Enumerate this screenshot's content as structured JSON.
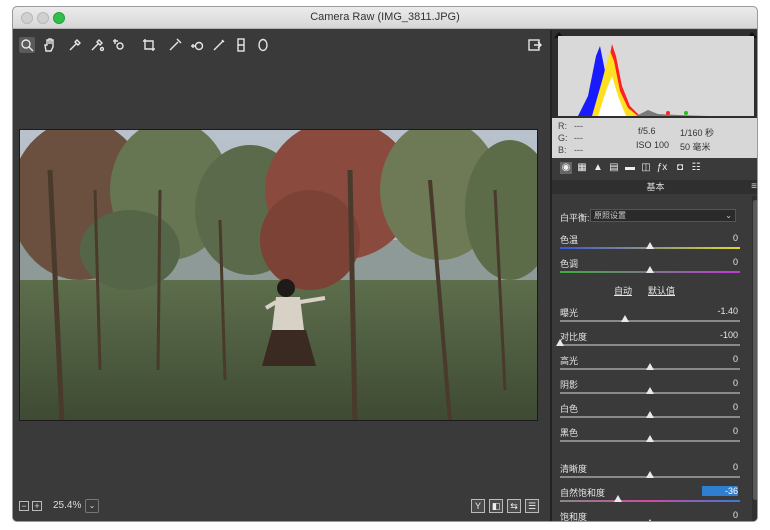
{
  "window": {
    "title": "Camera Raw (IMG_3811.JPG)"
  },
  "toolbar": {
    "tools": [
      {
        "name": "zoom-tool",
        "glyph": "⌕"
      },
      {
        "name": "hand-tool",
        "glyph": "✋"
      },
      {
        "name": "white-balance-tool",
        "glyph": "✎"
      },
      {
        "name": "color-sampler-tool",
        "glyph": "✎"
      },
      {
        "name": "targeted-adjustment-tool",
        "glyph": "◎"
      },
      {
        "name": "crop-tool",
        "glyph": "⌗"
      },
      {
        "name": "straighten-tool",
        "glyph": "⟋"
      },
      {
        "name": "spot-removal-tool",
        "glyph": "⊙"
      },
      {
        "name": "adjustment-brush-tool",
        "glyph": "✐"
      },
      {
        "name": "graduated-filter-tool",
        "glyph": "▮"
      },
      {
        "name": "radial-filter-tool",
        "glyph": "◯"
      }
    ]
  },
  "bottom": {
    "zoom": "25.4%",
    "zoom_out": "−",
    "zoom_in": "+",
    "zoom_dropdown": "⌄",
    "view_buttons": [
      "Y",
      "◧",
      "⇆",
      "☰"
    ]
  },
  "info": {
    "r_label": "R:",
    "r_value": "---",
    "g_label": "G:",
    "g_value": "---",
    "b_label": "B:",
    "b_value": "---",
    "aperture": "f/5.6",
    "shutter": "1/160 秒",
    "iso": "ISO 100",
    "focal": "50 毫米"
  },
  "panel": {
    "title": "基本",
    "menu_icon": "≡",
    "white_balance_label": "白平衡:",
    "white_balance_value": "原照设置",
    "auto_label": "自动",
    "default_label": "默认值",
    "colors": {
      "accent": "#2f7fd0",
      "background": "#3a3a3a"
    },
    "sliders": [
      {
        "name": "色温",
        "value": "0",
        "level": 0.5,
        "track": "temp"
      },
      {
        "name": "色调",
        "value": "0",
        "level": 0.5,
        "track": "tint"
      },
      {
        "name": "曝光",
        "value": "-1.40",
        "level": 0.36,
        "track": "plain"
      },
      {
        "name": "对比度",
        "value": "-100",
        "level": 0.0,
        "track": "plain"
      },
      {
        "name": "高光",
        "value": "0",
        "level": 0.5,
        "track": "plain"
      },
      {
        "name": "阴影",
        "value": "0",
        "level": 0.5,
        "track": "plain"
      },
      {
        "name": "白色",
        "value": "0",
        "level": 0.5,
        "track": "plain"
      },
      {
        "name": "黑色",
        "value": "0",
        "level": 0.5,
        "track": "plain"
      },
      {
        "name": "清晰度",
        "value": "0",
        "level": 0.5,
        "track": "plain"
      },
      {
        "name": "自然饱和度",
        "value": "-36",
        "level": 0.32,
        "track": "vibrance",
        "highlight": true
      },
      {
        "name": "饱和度",
        "value": "0",
        "level": 0.5,
        "track": "sat"
      }
    ]
  },
  "panel_tabs": [
    "◉",
    "▦",
    "▲",
    "▤",
    "▬",
    "◫",
    "ƒx",
    "◘",
    "☷"
  ]
}
